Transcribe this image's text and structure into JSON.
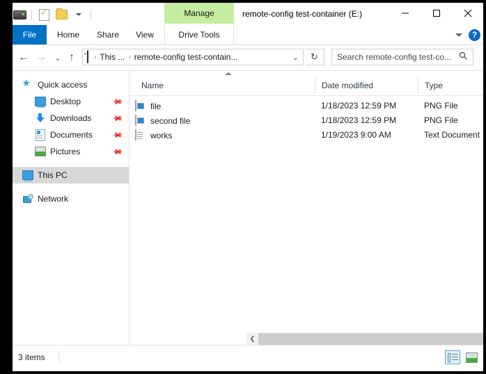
{
  "window": {
    "title": "remote-config test-container (E:)",
    "controls": {
      "minimize": "minimize-icon",
      "maximize": "maximize-icon",
      "close": "close-icon"
    }
  },
  "quick_access_toolbar": {
    "items": [
      {
        "name": "drive-icon",
        "label": ""
      },
      {
        "name": "properties-icon",
        "label": ""
      },
      {
        "name": "new-folder-icon",
        "label": ""
      },
      {
        "name": "customize-caret-icon",
        "label": ""
      }
    ]
  },
  "contextual_tab": {
    "label": "Manage",
    "color": "#c4eda0"
  },
  "ribbon": {
    "tabs": [
      {
        "label": "File",
        "active": true
      },
      {
        "label": "Home",
        "active": false
      },
      {
        "label": "Share",
        "active": false
      },
      {
        "label": "View",
        "active": false
      },
      {
        "label": "Drive Tools",
        "active": false
      }
    ],
    "file_tab_color": "#0072c6",
    "expand_icon": "chevron-down-icon",
    "help_label": "?"
  },
  "navigation": {
    "back": "←",
    "forward": "→",
    "recent": "⌄",
    "up": "↑"
  },
  "breadcrumb": {
    "drive_icon": "drive-icon",
    "separator": "›",
    "items": [
      "This ...",
      "remote-config test-contain..."
    ],
    "dropdown": "⌄"
  },
  "refresh": {
    "icon": "↻"
  },
  "search": {
    "placeholder": "Search remote-config test-co...",
    "icon": "search-icon"
  },
  "sidebar": {
    "items": [
      {
        "label": "Quick access",
        "icon": "quick-access-icon",
        "level": 0,
        "pinned": false,
        "selected": false
      },
      {
        "label": "Desktop",
        "icon": "desktop-icon",
        "level": 1,
        "pinned": true,
        "selected": false
      },
      {
        "label": "Downloads",
        "icon": "downloads-icon",
        "level": 1,
        "pinned": true,
        "selected": false
      },
      {
        "label": "Documents",
        "icon": "documents-icon",
        "level": 1,
        "pinned": true,
        "selected": false
      },
      {
        "label": "Pictures",
        "icon": "pictures-icon",
        "level": 1,
        "pinned": true,
        "selected": false
      },
      {
        "label": "This PC",
        "icon": "this-pc-icon",
        "level": 0,
        "pinned": false,
        "selected": true
      },
      {
        "label": "Network",
        "icon": "network-icon",
        "level": 0,
        "pinned": false,
        "selected": false
      }
    ],
    "pin_glyph": "📌"
  },
  "file_list": {
    "sort_column": "Name",
    "sort_direction": "ascending",
    "columns": [
      "Name",
      "Date modified",
      "Type"
    ],
    "rows": [
      {
        "name": "file",
        "date": "1/18/2023 12:59 PM",
        "type": "PNG File",
        "icon": "png-file-icon"
      },
      {
        "name": "second file",
        "date": "1/18/2023 12:59 PM",
        "type": "PNG File",
        "icon": "png-file-icon"
      },
      {
        "name": "works",
        "date": "1/19/2023 9:00 AM",
        "type": "Text Document",
        "icon": "text-document-icon"
      }
    ]
  },
  "scrollbar": {
    "left_arrow": "❮",
    "right_arrow": "❯"
  },
  "status_bar": {
    "item_count": "3 items",
    "views": [
      {
        "name": "details-view-button",
        "active": true
      },
      {
        "name": "large-icons-view-button",
        "active": false
      }
    ]
  }
}
